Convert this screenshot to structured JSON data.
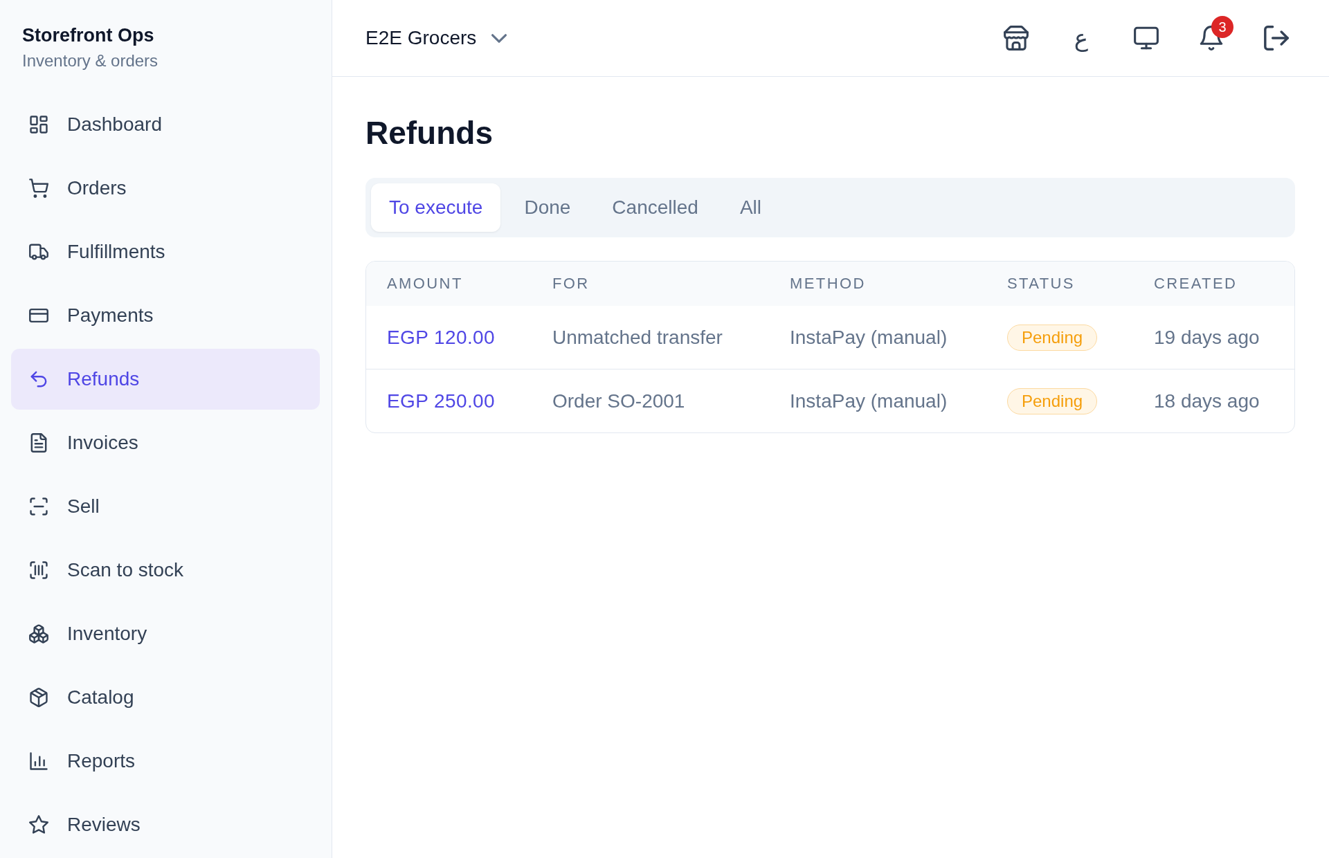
{
  "sidebar": {
    "title": "Storefront Ops",
    "subtitle": "Inventory & orders",
    "items": [
      {
        "label": "Dashboard",
        "selected": false
      },
      {
        "label": "Orders",
        "selected": false
      },
      {
        "label": "Fulfillments",
        "selected": false
      },
      {
        "label": "Payments",
        "selected": false
      },
      {
        "label": "Refunds",
        "selected": true
      },
      {
        "label": "Invoices",
        "selected": false
      },
      {
        "label": "Sell",
        "selected": false
      },
      {
        "label": "Scan to stock",
        "selected": false
      },
      {
        "label": "Inventory",
        "selected": false
      },
      {
        "label": "Catalog",
        "selected": false
      },
      {
        "label": "Reports",
        "selected": false
      },
      {
        "label": "Reviews",
        "selected": false
      }
    ]
  },
  "header": {
    "store_selector": "E2E Grocers",
    "language_toggle": "ع",
    "notification_count": "3"
  },
  "page": {
    "title": "Refunds",
    "tabs": [
      {
        "label": "To execute",
        "selected": true
      },
      {
        "label": "Done",
        "selected": false
      },
      {
        "label": "Cancelled",
        "selected": false
      },
      {
        "label": "All",
        "selected": false
      }
    ],
    "table": {
      "columns": [
        "AMOUNT",
        "FOR",
        "METHOD",
        "STATUS",
        "CREATED"
      ],
      "rows": [
        {
          "amount": "EGP 120.00",
          "for": "Unmatched transfer",
          "method": "InstaPay (manual)",
          "status": "Pending",
          "created": "19 days ago"
        },
        {
          "amount": "EGP 250.00",
          "for": "Order SO-2001",
          "method": "InstaPay (manual)",
          "status": "Pending",
          "created": "18 days ago"
        }
      ]
    }
  }
}
